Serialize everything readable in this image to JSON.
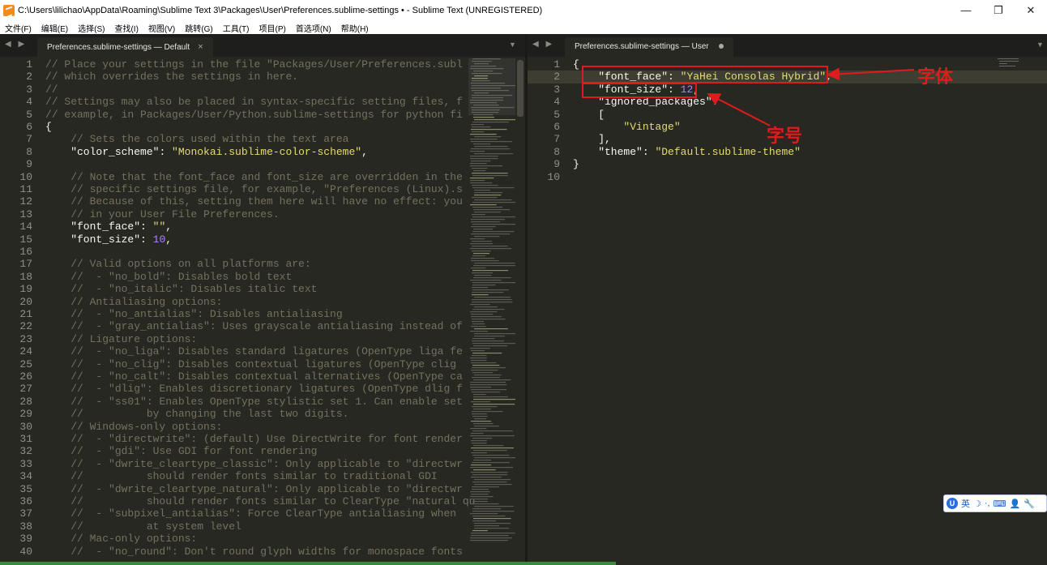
{
  "window": {
    "title": "C:\\Users\\lilichao\\AppData\\Roaming\\Sublime Text 3\\Packages\\User\\Preferences.sublime-settings • - Sublime Text (UNREGISTERED)",
    "controls": [
      "—",
      "❐",
      "✕"
    ]
  },
  "menu": [
    "文件(F)",
    "编辑(E)",
    "选择(S)",
    "查找(I)",
    "视图(V)",
    "跳转(G)",
    "工具(T)",
    "项目(P)",
    "首选项(N)",
    "帮助(H)"
  ],
  "left": {
    "tab_label": "Preferences.sublime-settings — Default",
    "close_glyph": "×",
    "nav": "◀ ▶",
    "dropdown": "▼",
    "lines": [
      {
        "n": "1",
        "parts": [
          [
            "cm",
            "// Place your settings in the file \"Packages/User/Preferences.subl"
          ]
        ]
      },
      {
        "n": "2",
        "parts": [
          [
            "cm",
            "// which overrides the settings in here."
          ]
        ]
      },
      {
        "n": "3",
        "parts": [
          [
            "cm",
            "//"
          ]
        ]
      },
      {
        "n": "4",
        "parts": [
          [
            "cm",
            "// Settings may also be placed in syntax-specific setting files, f"
          ]
        ]
      },
      {
        "n": "5",
        "parts": [
          [
            "cm",
            "// example, in Packages/User/Python.sublime-settings for python fi"
          ]
        ]
      },
      {
        "n": "6",
        "parts": [
          [
            "plain",
            "{"
          ]
        ]
      },
      {
        "n": "7",
        "parts": [
          [
            "cm",
            "    // Sets the colors used within the text area"
          ]
        ]
      },
      {
        "n": "8",
        "parts": [
          [
            "key",
            "    \"color_scheme\""
          ],
          [
            "plain",
            ": "
          ],
          [
            "str",
            "\"Monokai.sublime-color-scheme\""
          ],
          [
            "plain",
            ","
          ]
        ]
      },
      {
        "n": "9",
        "parts": [
          [
            "plain",
            ""
          ]
        ]
      },
      {
        "n": "10",
        "parts": [
          [
            "cm",
            "    // Note that the font_face and font_size are overridden in the"
          ]
        ]
      },
      {
        "n": "11",
        "parts": [
          [
            "cm",
            "    // specific settings file, for example, \"Preferences (Linux).s"
          ]
        ]
      },
      {
        "n": "12",
        "parts": [
          [
            "cm",
            "    // Because of this, setting them here will have no effect: you"
          ]
        ]
      },
      {
        "n": "13",
        "parts": [
          [
            "cm",
            "    // in your User File Preferences."
          ]
        ]
      },
      {
        "n": "14",
        "parts": [
          [
            "key",
            "    \"font_face\""
          ],
          [
            "plain",
            ": "
          ],
          [
            "str",
            "\"\""
          ],
          [
            "plain",
            ","
          ]
        ]
      },
      {
        "n": "15",
        "parts": [
          [
            "key",
            "    \"font_size\""
          ],
          [
            "plain",
            ": "
          ],
          [
            "num",
            "10"
          ],
          [
            "plain",
            ","
          ]
        ]
      },
      {
        "n": "16",
        "parts": [
          [
            "plain",
            ""
          ]
        ]
      },
      {
        "n": "17",
        "parts": [
          [
            "cm",
            "    // Valid options on all platforms are:"
          ]
        ]
      },
      {
        "n": "18",
        "parts": [
          [
            "cm",
            "    //  - \"no_bold\": Disables bold text"
          ]
        ]
      },
      {
        "n": "19",
        "parts": [
          [
            "cm",
            "    //  - \"no_italic\": Disables italic text"
          ]
        ]
      },
      {
        "n": "20",
        "parts": [
          [
            "cm",
            "    // Antialiasing options:"
          ]
        ]
      },
      {
        "n": "21",
        "parts": [
          [
            "cm",
            "    //  - \"no_antialias\": Disables antialiasing"
          ]
        ]
      },
      {
        "n": "22",
        "parts": [
          [
            "cm",
            "    //  - \"gray_antialias\": Uses grayscale antialiasing instead of"
          ]
        ]
      },
      {
        "n": "23",
        "parts": [
          [
            "cm",
            "    // Ligature options:"
          ]
        ]
      },
      {
        "n": "24",
        "parts": [
          [
            "cm",
            "    //  - \"no_liga\": Disables standard ligatures (OpenType liga fe"
          ]
        ]
      },
      {
        "n": "25",
        "parts": [
          [
            "cm",
            "    //  - \"no_clig\": Disables contextual ligatures (OpenType clig"
          ]
        ]
      },
      {
        "n": "26",
        "parts": [
          [
            "cm",
            "    //  - \"no_calt\": Disables contextual alternatives (OpenType ca"
          ]
        ]
      },
      {
        "n": "27",
        "parts": [
          [
            "cm",
            "    //  - \"dlig\": Enables discretionary ligatures (OpenType dlig f"
          ]
        ]
      },
      {
        "n": "28",
        "parts": [
          [
            "cm",
            "    //  - \"ss01\": Enables OpenType stylistic set 1. Can enable set"
          ]
        ]
      },
      {
        "n": "29",
        "parts": [
          [
            "cm",
            "    //          by changing the last two digits."
          ]
        ]
      },
      {
        "n": "30",
        "parts": [
          [
            "cm",
            "    // Windows-only options:"
          ]
        ]
      },
      {
        "n": "31",
        "parts": [
          [
            "cm",
            "    //  - \"directwrite\": (default) Use DirectWrite for font render"
          ]
        ]
      },
      {
        "n": "32",
        "parts": [
          [
            "cm",
            "    //  - \"gdi\": Use GDI for font rendering"
          ]
        ]
      },
      {
        "n": "33",
        "parts": [
          [
            "cm",
            "    //  - \"dwrite_cleartype_classic\": Only applicable to \"directwr"
          ]
        ]
      },
      {
        "n": "34",
        "parts": [
          [
            "cm",
            "    //          should render fonts similar to traditional GDI"
          ]
        ]
      },
      {
        "n": "35",
        "parts": [
          [
            "cm",
            "    //  - \"dwrite_cleartype_natural\": Only applicable to \"directwr"
          ]
        ]
      },
      {
        "n": "36",
        "parts": [
          [
            "cm",
            "    //          should render fonts similar to ClearType \"natural qu"
          ]
        ]
      },
      {
        "n": "37",
        "parts": [
          [
            "cm",
            "    //  - \"subpixel_antialias\": Force ClearType antialiasing when"
          ]
        ]
      },
      {
        "n": "38",
        "parts": [
          [
            "cm",
            "    //          at system level"
          ]
        ]
      },
      {
        "n": "39",
        "parts": [
          [
            "cm",
            "    // Mac-only options:"
          ]
        ]
      },
      {
        "n": "40",
        "parts": [
          [
            "cm",
            "    //  - \"no_round\": Don't round glyph widths for monospace fonts"
          ]
        ]
      }
    ]
  },
  "right": {
    "tab_label": "Preferences.sublime-settings — User",
    "nav": "◀ ▶",
    "dropdown": "▼",
    "lines": [
      {
        "n": "1",
        "parts": [
          [
            "plain",
            "{"
          ]
        ]
      },
      {
        "n": "2",
        "parts": [
          [
            "key",
            "    \"font_face\""
          ],
          [
            "plain",
            ": "
          ],
          [
            "str",
            "\"YaHei Consolas Hybrid\""
          ],
          [
            "plain",
            ","
          ]
        ]
      },
      {
        "n": "3",
        "parts": [
          [
            "key",
            "    \"font_size\""
          ],
          [
            "plain",
            ": "
          ],
          [
            "num",
            "12"
          ],
          [
            "plain",
            ","
          ]
        ]
      },
      {
        "n": "4",
        "parts": [
          [
            "key",
            "    \"ignored_packages\""
          ],
          [
            "plain",
            ":"
          ]
        ]
      },
      {
        "n": "5",
        "parts": [
          [
            "plain",
            "    ["
          ]
        ]
      },
      {
        "n": "6",
        "parts": [
          [
            "str",
            "        \"Vintage\""
          ]
        ]
      },
      {
        "n": "7",
        "parts": [
          [
            "plain",
            "    ],"
          ]
        ]
      },
      {
        "n": "8",
        "parts": [
          [
            "key",
            "    \"theme\""
          ],
          [
            "plain",
            ": "
          ],
          [
            "str",
            "\"Default.sublime-theme\""
          ]
        ]
      },
      {
        "n": "9",
        "parts": [
          [
            "plain",
            "}"
          ]
        ]
      },
      {
        "n": "10",
        "parts": [
          [
            "plain",
            ""
          ]
        ]
      }
    ]
  },
  "annotations": {
    "font_label": "字体",
    "size_label": "字号",
    "color": "#e01b1b"
  },
  "ime": {
    "logo": "U",
    "mode": "英",
    "icons": [
      "☽",
      "·,",
      "⌨",
      "👤",
      "🔧"
    ]
  }
}
